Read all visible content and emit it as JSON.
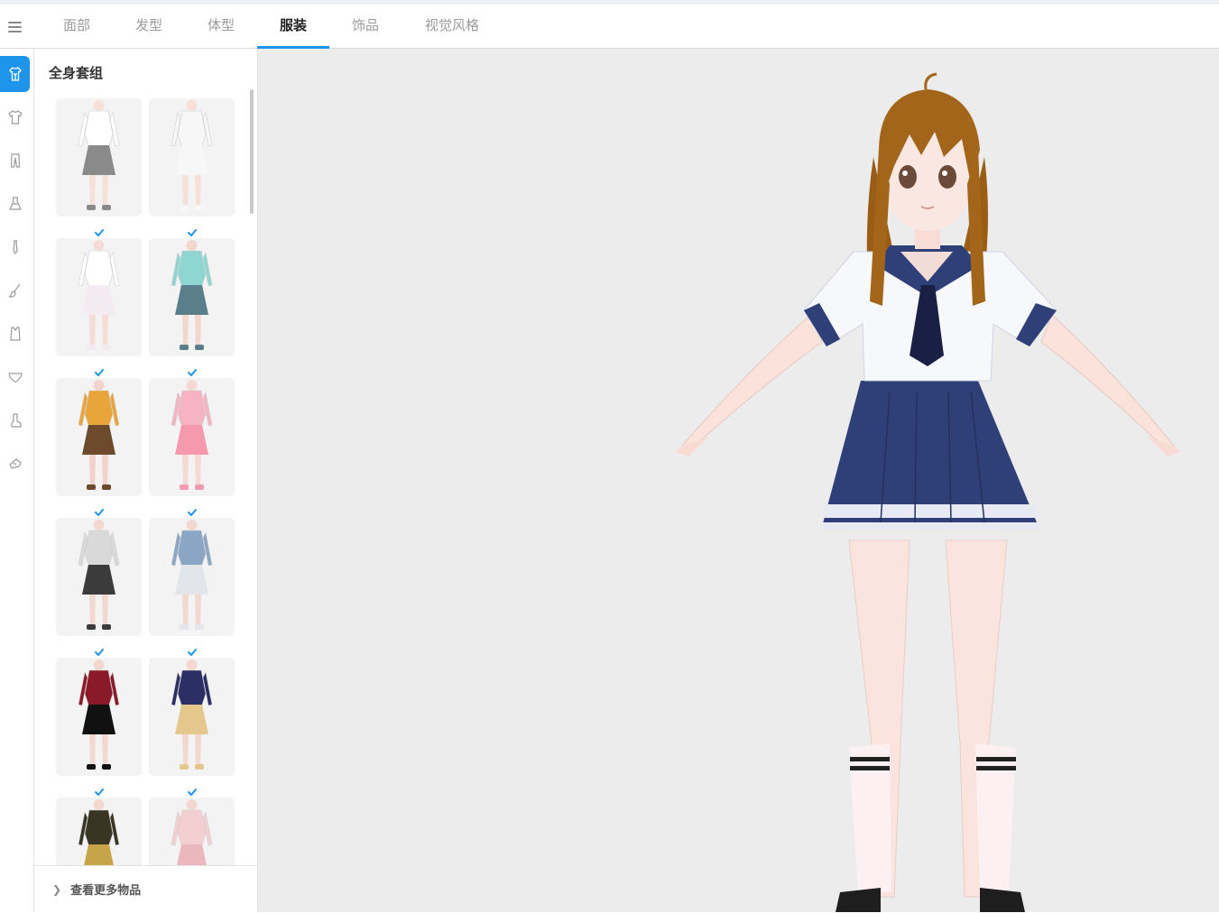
{
  "tabs": [
    {
      "label": "面部",
      "active": false
    },
    {
      "label": "发型",
      "active": false
    },
    {
      "label": "体型",
      "active": false
    },
    {
      "label": "服装",
      "active": true
    },
    {
      "label": "饰品",
      "active": false
    },
    {
      "label": "视觉风格",
      "active": false
    }
  ],
  "sidebar": {
    "items": [
      {
        "icon": "full-outfit-icon",
        "active": true
      },
      {
        "icon": "shirt-icon",
        "active": false
      },
      {
        "icon": "pants-icon",
        "active": false
      },
      {
        "icon": "dress-icon",
        "active": false
      },
      {
        "icon": "tie-icon",
        "active": false
      },
      {
        "icon": "brush-icon",
        "active": false
      },
      {
        "icon": "vest-icon",
        "active": false
      },
      {
        "icon": "underwear-icon",
        "active": false
      },
      {
        "icon": "sock-icon",
        "active": false
      },
      {
        "icon": "shoe-icon",
        "active": false
      }
    ]
  },
  "panel": {
    "title": "全身套组",
    "more_label": "查看更多物品",
    "outfits": [
      {
        "name": "white-shirt-gray-pants",
        "checked": true
      },
      {
        "name": "white-shirt-dress",
        "checked": true
      },
      {
        "name": "white-frilly-dress",
        "checked": true
      },
      {
        "name": "teal-hoodie-shorts",
        "checked": true
      },
      {
        "name": "brown-lolita-dress",
        "checked": true
      },
      {
        "name": "pink-lolita-dress",
        "checked": true
      },
      {
        "name": "gray-vest-suit",
        "checked": true
      },
      {
        "name": "blue-maid-dress",
        "checked": true
      },
      {
        "name": "red-black-dress",
        "checked": true
      },
      {
        "name": "navy-starry-dress",
        "checked": true
      },
      {
        "name": "black-gold-dress",
        "checked": false
      },
      {
        "name": "pink-gown",
        "checked": false
      }
    ]
  },
  "colors": {
    "accent": "#1e95ea",
    "viewport_bg": "#ececec"
  }
}
